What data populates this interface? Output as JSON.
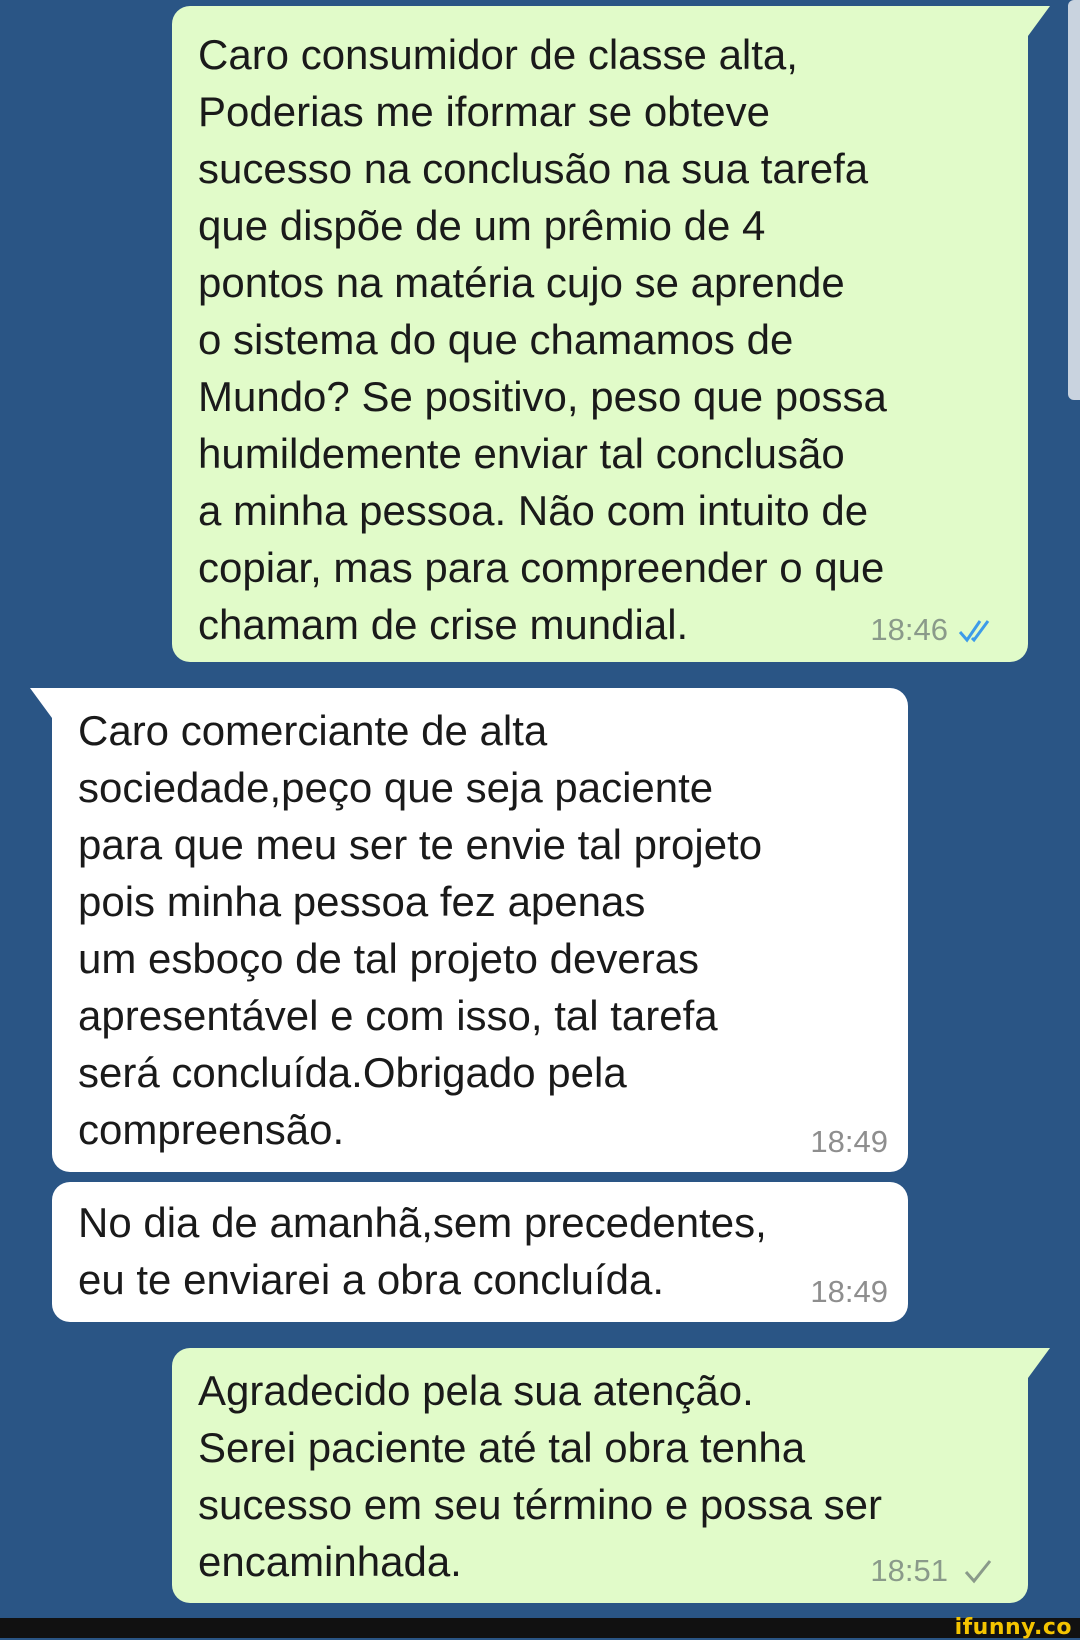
{
  "messages": [
    {
      "direction": "outgoing",
      "text": "Caro consumidor de classe alta,\nPoderias me iformar se obteve\nsucesso na conclusão na sua tarefa\nque dispõe de um prêmio de 4\npontos na matéria cujo se aprende\no sistema do que chamamos de\nMundo? Se positivo, peso que possa\nhumildemente enviar tal conclusão\na minha pessoa. Não com intuito de\ncopiar, mas para compreender o que\nchamam de crise mundial.",
      "time": "18:46",
      "status": "read"
    },
    {
      "direction": "incoming",
      "text": "Caro comerciante de alta\nsociedade,peço que seja paciente\npara que meu ser te envie tal projeto\npois minha pessoa fez apenas\num esboço de tal projeto deveras\napresentável e com isso, tal tarefa\nserá concluída.Obrigado pela\ncompreensão.",
      "time": "18:49"
    },
    {
      "direction": "incoming",
      "text": "No dia de amanhã,sem precedentes,\neu te enviarei a obra concluída.",
      "time": "18:49"
    },
    {
      "direction": "outgoing",
      "text": "Agradecido pela sua atenção.\nSerei paciente até tal obra tenha\nsucesso em seu término e possa ser\nencaminhada.",
      "time": "18:51",
      "status": "sent"
    }
  ],
  "watermark": "ifunny.co",
  "colors": {
    "background": "#2a5585",
    "outgoing_bubble": "#e1fbc9",
    "incoming_bubble": "#ffffff",
    "read_tick": "#3d9be9",
    "sent_tick": "#8a9a8a",
    "watermark": "#f4c400"
  }
}
